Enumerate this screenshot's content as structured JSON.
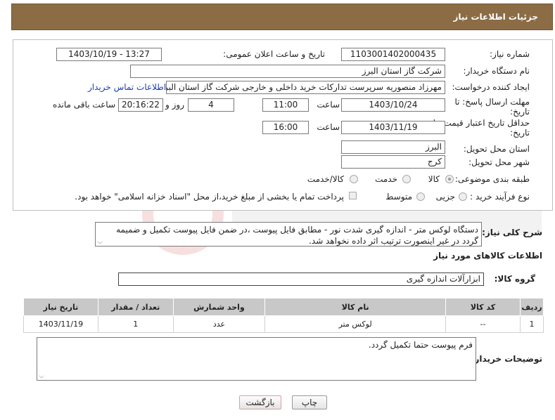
{
  "header": {
    "title": "جزئیات اطلاعات نیاز"
  },
  "form": {
    "need_number": {
      "label": "شماره نیاز:",
      "value": "1103001402000435"
    },
    "announce_datetime": {
      "label": "تاریخ و ساعت اعلان عمومی:",
      "value": "1403/10/19 - 13:27"
    },
    "buyer_org": {
      "label": "نام دستگاه خریدار:",
      "value": "شرکت گاز استان البرز"
    },
    "requester": {
      "label": "ایجاد کننده درخواست:",
      "value": "مهرزاد منصوریه سرپرست تدارکات خرید داخلی و خارجی شرکت گاز استان البرز",
      "contact_link": "اطلاعات تماس خریدار"
    },
    "reply_deadline": {
      "label_line1": "مهلت ارسال پاسخ: تا",
      "label_line2": "تاریخ:",
      "date": "1403/10/24",
      "time_label": "ساعت",
      "time": "11:00",
      "days": "4",
      "days_label": "روز و",
      "remaining": "20:16:22",
      "remaining_label": "ساعت باقی مانده"
    },
    "price_validity": {
      "label_line1": "حداقل تاریخ اعتبار قیمت: تا",
      "label_line2": "تاریخ:",
      "date": "1403/11/19",
      "time_label": "ساعت",
      "time": "16:00"
    },
    "province": {
      "label": "استان محل تحویل:",
      "value": "البرز"
    },
    "city": {
      "label": "شهر محل تحویل:",
      "value": "کرج"
    },
    "category": {
      "label": "طبقه بندی موضوعی:",
      "options": [
        "کالا",
        "خدمت",
        "کالا/خدمت"
      ],
      "selected": "کالا"
    },
    "process_type": {
      "label": "نوع فرآیند خرید :",
      "options": [
        "جزیی",
        "متوسط"
      ],
      "payment_note": "پرداخت تمام یا بخشی از مبلغ خرید،از محل \"اسناد خزانه اسلامی\" خواهد بود."
    }
  },
  "description": {
    "label": "شرح کلی نیاز:",
    "text": "دستگاه لوکس متر - اندازه گیری شدت نور - مطابق فایل پیوست ،در ضمن فایل پیوست تکمیل و ضمیمه گردد در غیر اینصورت ترتیب اثر داده نخواهد شد."
  },
  "goods_section": {
    "title": "اطلاعات کالاهای مورد نیاز",
    "group_label": "گروه کالا:",
    "group_value": "ابزارآلات اندازه گیری",
    "columns": [
      "ردیف",
      "کد کالا",
      "نام کالا",
      "واحد شمارش",
      "تعداد / مقدار",
      "تاریخ نیاز"
    ],
    "rows": [
      [
        "1",
        "--",
        "لوکس متر",
        "عدد",
        "1",
        "1403/11/19"
      ]
    ]
  },
  "buyer_notes": {
    "label": "توضیحات خریدار:",
    "text": "فرم پیوست حتما تکمیل گردد."
  },
  "buttons": {
    "print": "چاپ",
    "back": "بازگشت"
  },
  "colors": {
    "header_bg": "#8b6c45",
    "link": "#1a3fb5",
    "back_button_border": "#d9a0a0"
  }
}
